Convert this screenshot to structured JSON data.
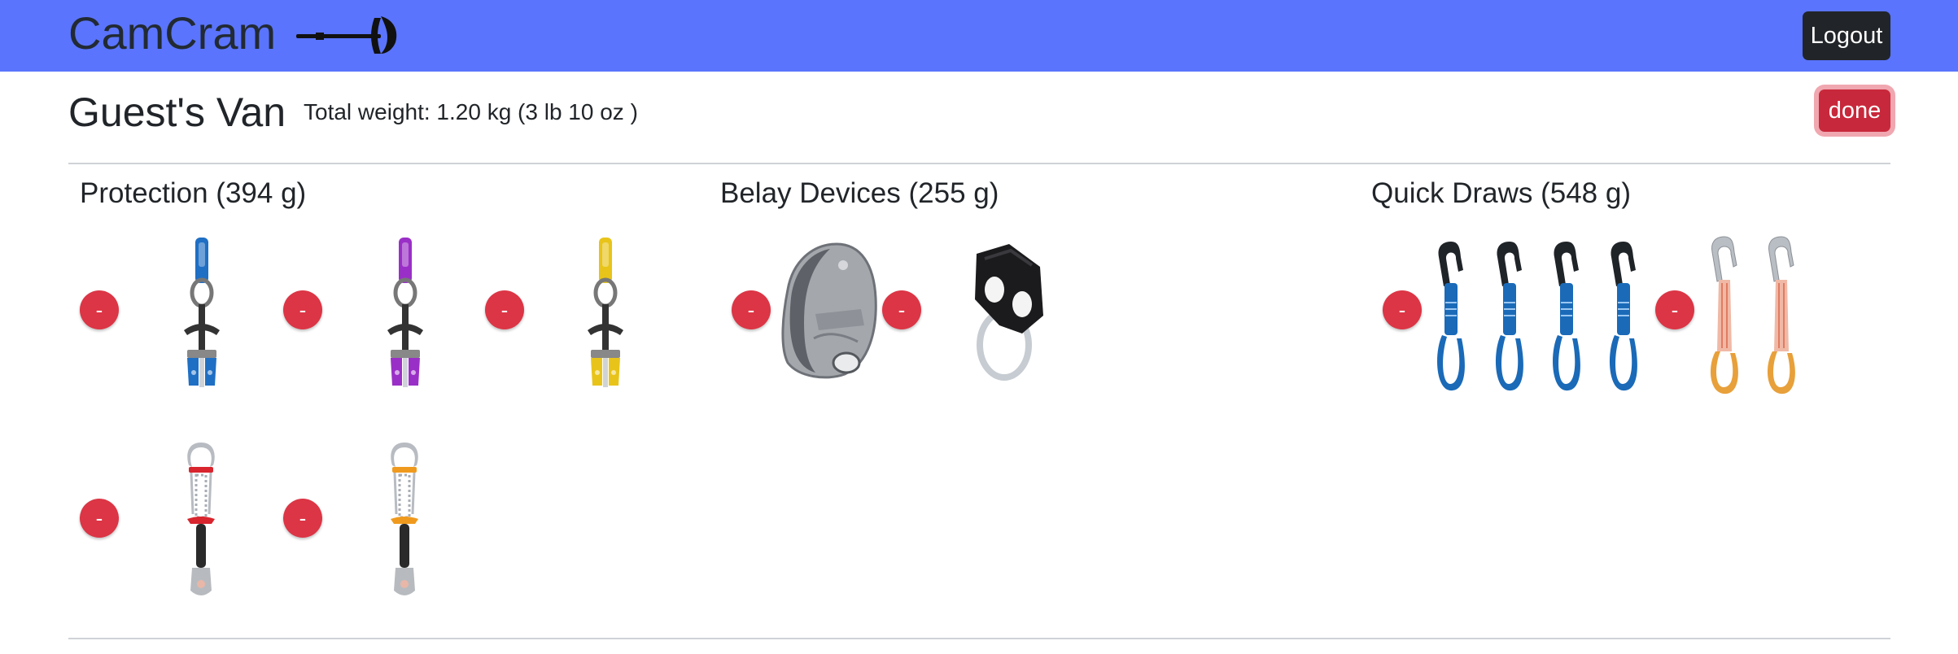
{
  "brand": {
    "name": "CamCram",
    "logo_icon": "climbing-hammer-icon"
  },
  "navbar": {
    "logout_label": "Logout",
    "background": "#5a74fd"
  },
  "rack": {
    "title": "Guest's Van",
    "total_weight": "Total weight: 1.20 kg (3 lb 10 oz )",
    "done_label": "done"
  },
  "categories": [
    {
      "title": "Protection (394 g)",
      "items": [
        {
          "remove_label": "-",
          "icon": "blue-cam-icon",
          "color": "#1f6fc4"
        },
        {
          "remove_label": "-",
          "icon": "purple-cam-icon",
          "color": "#9a2fc7"
        },
        {
          "remove_label": "-",
          "icon": "yellow-cam-icon",
          "color": "#e8c41a"
        },
        {
          "remove_label": "-",
          "icon": "red-tricam-icon",
          "color": "#d8252e"
        },
        {
          "remove_label": "-",
          "icon": "orange-tricam-icon",
          "color": "#ef9a1e"
        }
      ]
    },
    {
      "title": "Belay Devices (255 g)",
      "items": [
        {
          "remove_label": "-",
          "icon": "grigri-icon",
          "color": "#8a8d91"
        },
        {
          "remove_label": "-",
          "icon": "atc-guide-icon",
          "color": "#1b1b1d"
        }
      ]
    },
    {
      "title": "Quick Draws (548 g)",
      "items": [
        {
          "remove_label": "-",
          "icon": "blue-quickdraw-set-icon",
          "color": "#1a6ab8"
        },
        {
          "remove_label": "-",
          "icon": "orange-quickdraw-set-icon",
          "color": "#e8a03a"
        }
      ]
    }
  ]
}
